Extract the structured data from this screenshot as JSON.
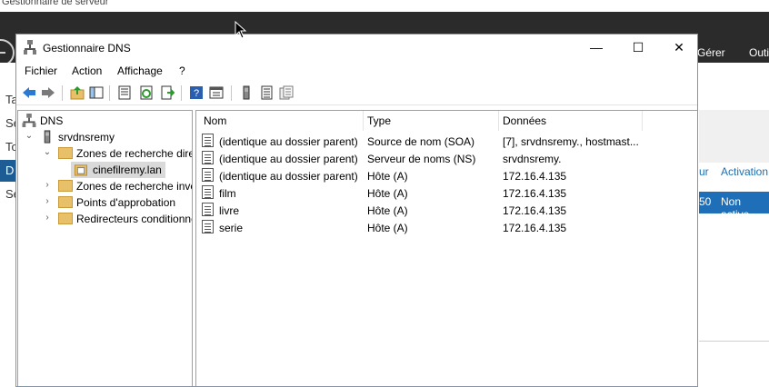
{
  "background": {
    "title": "Gestionnaire de serveur",
    "menu": [
      "Gérer",
      "Outi"
    ],
    "left_items": [
      "Ta",
      "Se",
      "To",
      "D",
      "Se"
    ],
    "right": {
      "col1": "ur",
      "col2": "Activation",
      "row_value1": "50",
      "row_value2": "Non active"
    }
  },
  "window": {
    "title": "Gestionnaire DNS",
    "controls": {
      "minimize": "—",
      "maximize": "☐",
      "close": "✕"
    },
    "menu": [
      "Fichier",
      "Action",
      "Affichage",
      "?"
    ],
    "toolbar_icons": [
      "back-arrow-icon",
      "forward-arrow-icon",
      "up-folder-icon",
      "show-hide-tree-icon",
      "properties-icon",
      "refresh-icon",
      "export-list-icon",
      "help-icon",
      "console-icon",
      "server-icon",
      "zone-list-icon",
      "records-icon"
    ]
  },
  "tree": {
    "root": "DNS",
    "server": "srvdnsremy",
    "children": [
      {
        "label": "Zones de recherche directe",
        "expanded": true
      },
      {
        "label": "cinefilremy.lan",
        "selected": true
      },
      {
        "label": "Zones de recherche inverse",
        "expanded": false
      },
      {
        "label": "Points d'approbation",
        "expanded": false
      },
      {
        "label": "Redirecteurs conditionnels",
        "expanded": false
      }
    ]
  },
  "list": {
    "columns": [
      "Nom",
      "Type",
      "Données"
    ],
    "rows": [
      {
        "name": "(identique au dossier parent)",
        "type": "Source de nom (SOA)",
        "data": "[7], srvdnsremy., hostmast..."
      },
      {
        "name": "(identique au dossier parent)",
        "type": "Serveur de noms (NS)",
        "data": "srvdnsremy."
      },
      {
        "name": "(identique au dossier parent)",
        "type": "Hôte (A)",
        "data": "172.16.4.135"
      },
      {
        "name": "film",
        "type": "Hôte (A)",
        "data": "172.16.4.135"
      },
      {
        "name": "livre",
        "type": "Hôte (A)",
        "data": "172.16.4.135"
      },
      {
        "name": "serie",
        "type": "Hôte (A)",
        "data": "172.16.4.135"
      }
    ]
  },
  "colors": {
    "accent": "#1e6fb8",
    "dark_bar": "#2b2b2b",
    "selection": "#cce8ff"
  }
}
